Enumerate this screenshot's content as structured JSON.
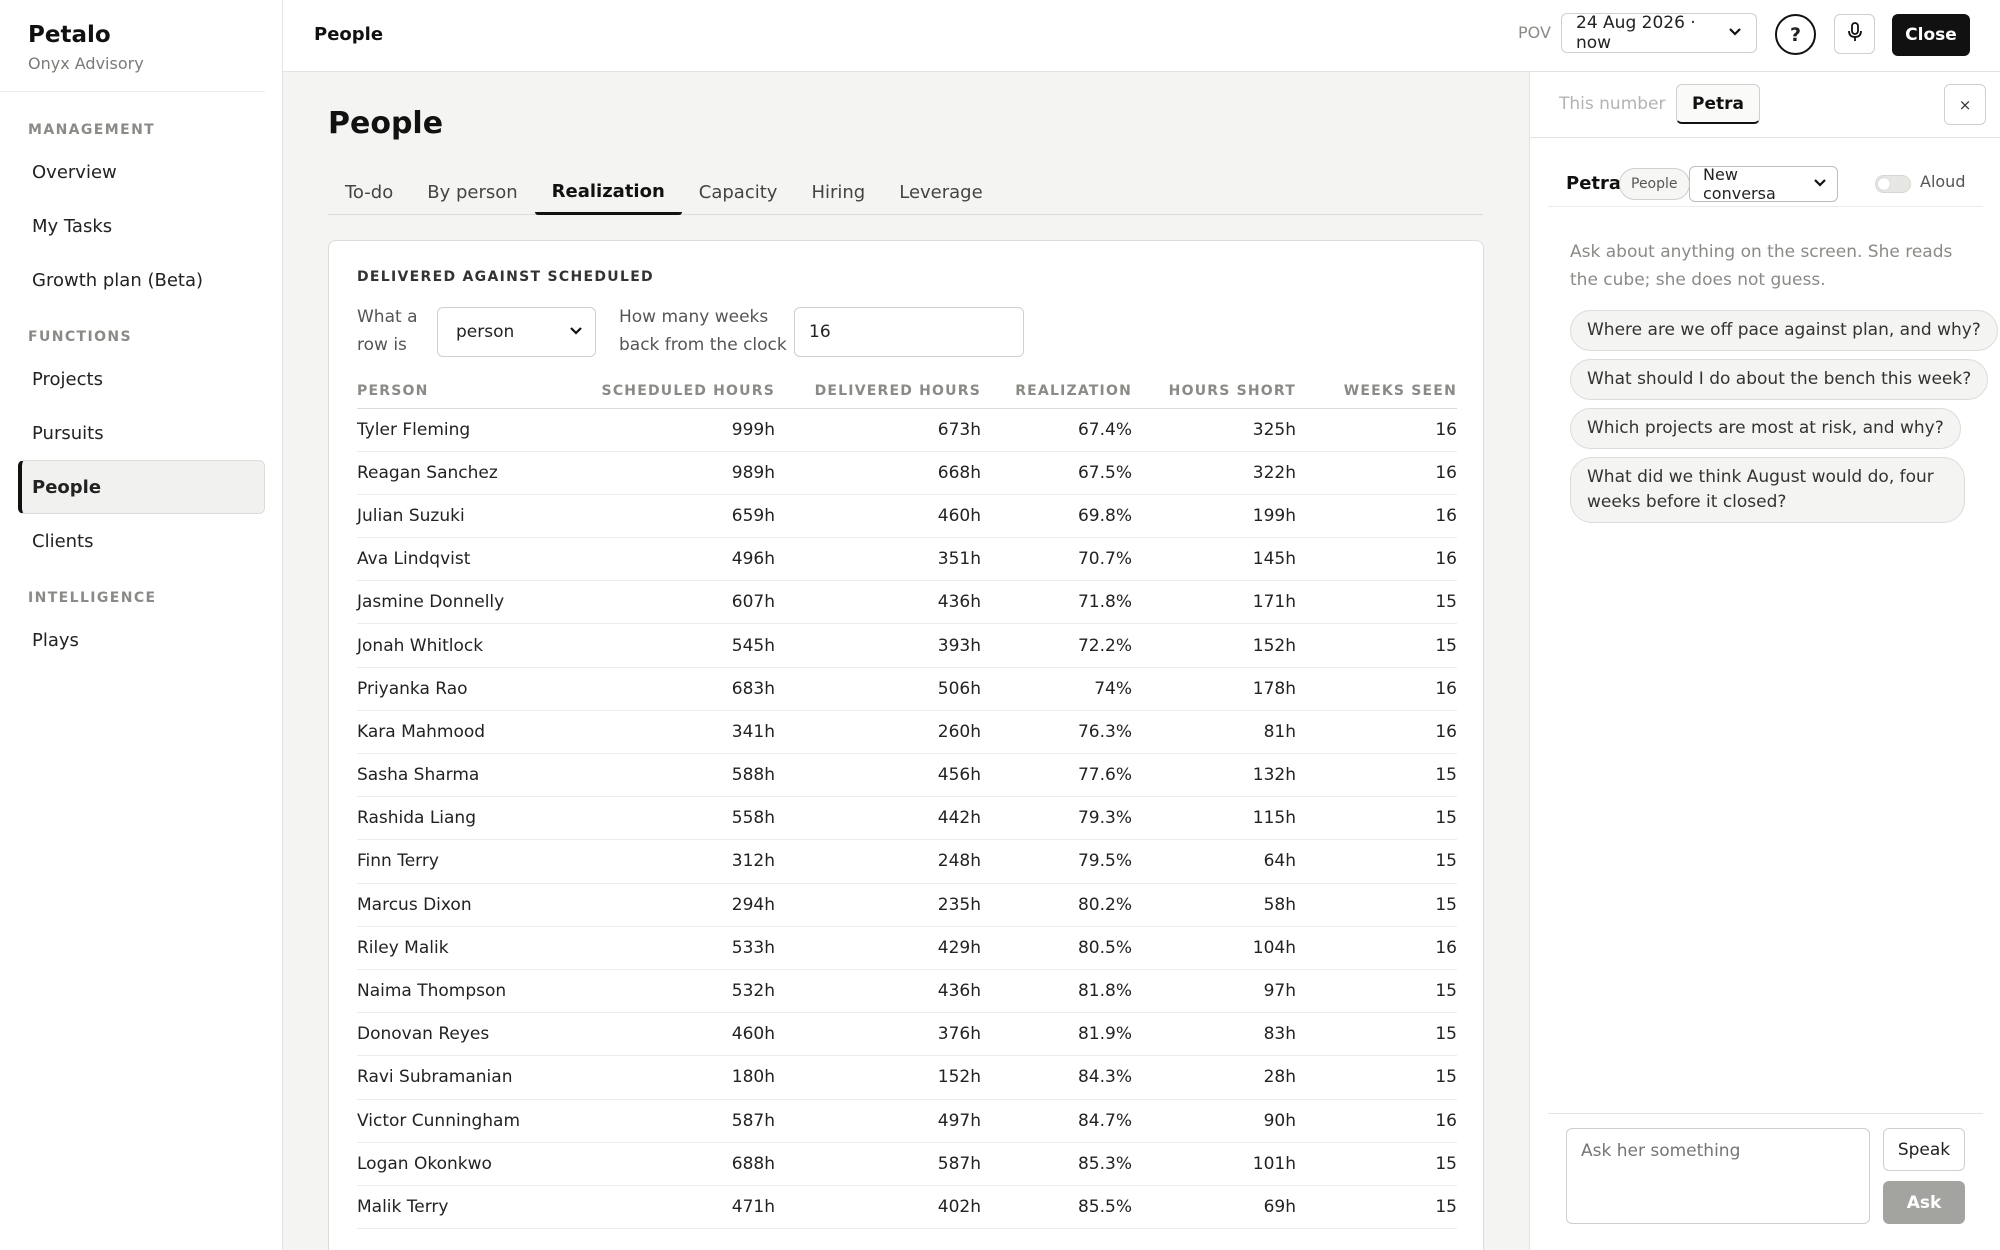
{
  "sidebar": {
    "brand": "Petalo",
    "org": "Onyx Advisory",
    "sections": [
      {
        "label": "MANAGEMENT",
        "items": [
          "Overview",
          "My Tasks",
          "Growth plan (Beta)"
        ]
      },
      {
        "label": "FUNCTIONS",
        "items": [
          "Projects",
          "Pursuits",
          "People",
          "Clients"
        ]
      },
      {
        "label": "INTELLIGENCE",
        "items": [
          "Plays"
        ]
      }
    ],
    "active": "People"
  },
  "topbar": {
    "title": "People",
    "pov_label": "POV",
    "pov_value": "24 Aug 2026 · now",
    "help": "?",
    "close": "Close"
  },
  "main": {
    "title": "People",
    "tabs": [
      "To-do",
      "By person",
      "Realization",
      "Capacity",
      "Hiring",
      "Leverage"
    ],
    "active_tab": "Realization",
    "card": {
      "heading": "DELIVERED AGAINST SCHEDULED",
      "row_label_1": "What a",
      "row_label_2": "row is",
      "row_value": "person",
      "weeks_label_1": "How many weeks",
      "weeks_label_2": "back from the clock",
      "weeks_value": "16"
    },
    "table": {
      "columns": [
        "PERSON",
        "SCHEDULED HOURS",
        "DELIVERED HOURS",
        "REALIZATION",
        "HOURS SHORT",
        "WEEKS SEEN"
      ],
      "rows": [
        [
          "Tyler Fleming",
          "999h",
          "673h",
          "67.4%",
          "325h",
          "16"
        ],
        [
          "Reagan Sanchez",
          "989h",
          "668h",
          "67.5%",
          "322h",
          "16"
        ],
        [
          "Julian Suzuki",
          "659h",
          "460h",
          "69.8%",
          "199h",
          "16"
        ],
        [
          "Ava Lindqvist",
          "496h",
          "351h",
          "70.7%",
          "145h",
          "16"
        ],
        [
          "Jasmine Donnelly",
          "607h",
          "436h",
          "71.8%",
          "171h",
          "15"
        ],
        [
          "Jonah Whitlock",
          "545h",
          "393h",
          "72.2%",
          "152h",
          "15"
        ],
        [
          "Priyanka Rao",
          "683h",
          "506h",
          "74%",
          "178h",
          "16"
        ],
        [
          "Kara Mahmood",
          "341h",
          "260h",
          "76.3%",
          "81h",
          "16"
        ],
        [
          "Sasha Sharma",
          "588h",
          "456h",
          "77.6%",
          "132h",
          "15"
        ],
        [
          "Rashida Liang",
          "558h",
          "442h",
          "79.3%",
          "115h",
          "15"
        ],
        [
          "Finn Terry",
          "312h",
          "248h",
          "79.5%",
          "64h",
          "15"
        ],
        [
          "Marcus Dixon",
          "294h",
          "235h",
          "80.2%",
          "58h",
          "15"
        ],
        [
          "Riley Malik",
          "533h",
          "429h",
          "80.5%",
          "104h",
          "16"
        ],
        [
          "Naima Thompson",
          "532h",
          "436h",
          "81.8%",
          "97h",
          "15"
        ],
        [
          "Donovan Reyes",
          "460h",
          "376h",
          "81.9%",
          "83h",
          "15"
        ],
        [
          "Ravi Subramanian",
          "180h",
          "152h",
          "84.3%",
          "28h",
          "15"
        ],
        [
          "Victor Cunningham",
          "587h",
          "497h",
          "84.7%",
          "90h",
          "16"
        ],
        [
          "Logan Okonkwo",
          "688h",
          "587h",
          "85.3%",
          "101h",
          "15"
        ],
        [
          "Malik Terry",
          "471h",
          "402h",
          "85.5%",
          "69h",
          "15"
        ]
      ]
    }
  },
  "panel": {
    "tab_inactive": "This number",
    "tab_active": "Petra",
    "close": "×",
    "assistant_name": "Petra",
    "context_badge": "People",
    "conversation": "New conversa",
    "aloud": "Aloud",
    "intro": "Ask about anything on the screen. She reads the cube; she does not guess.",
    "suggestions": [
      "Where are we off pace against plan, and why?",
      "What should I do about the bench this week?",
      "Which projects are most at risk, and why?",
      "What did we think August would do, four weeks before it closed?"
    ],
    "input_placeholder": "Ask her something",
    "speak": "Speak",
    "ask": "Ask"
  }
}
